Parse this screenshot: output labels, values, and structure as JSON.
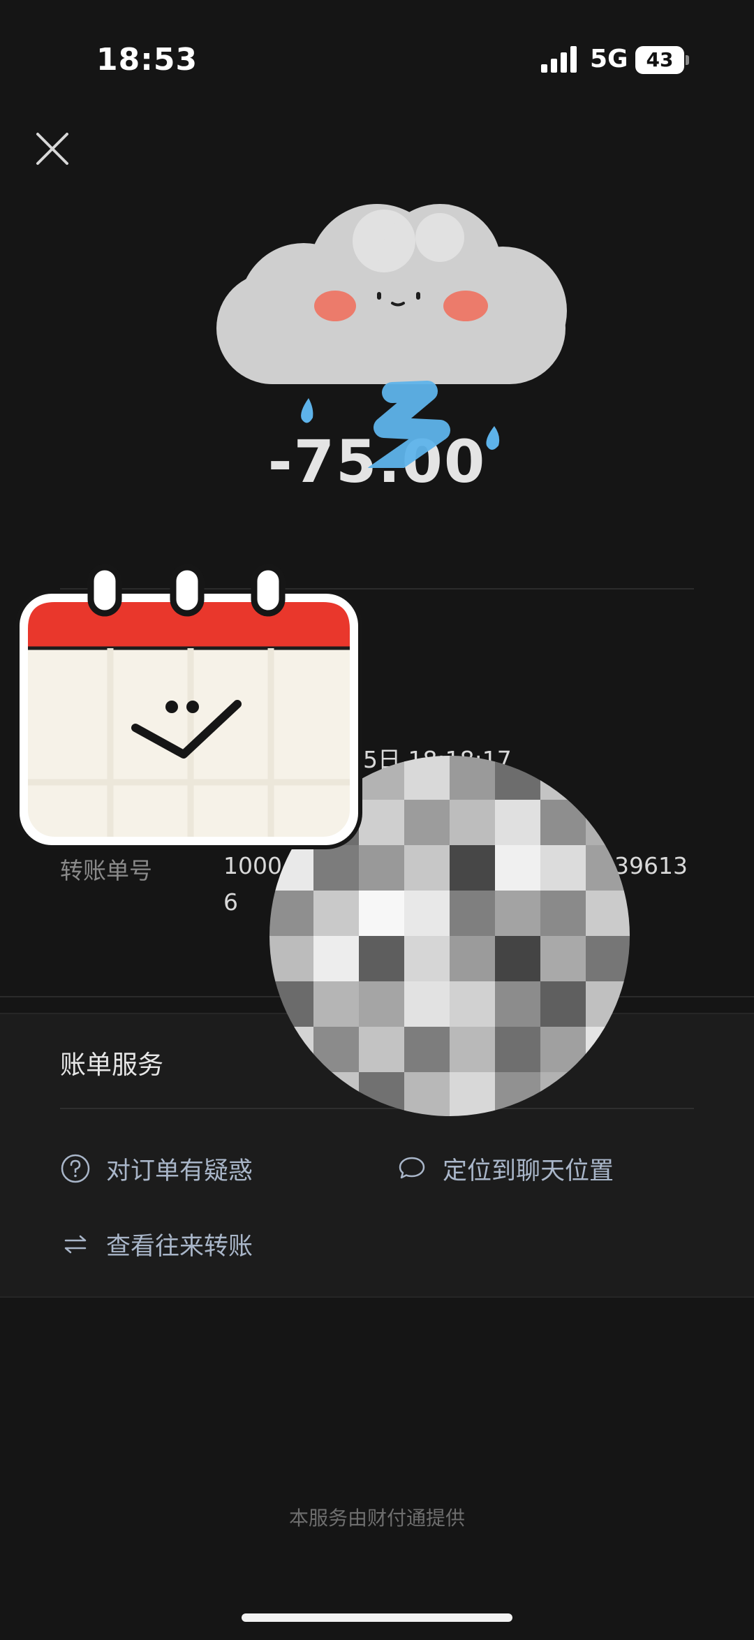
{
  "status_bar": {
    "time": "18:53",
    "network": "5G",
    "battery": "43"
  },
  "transaction": {
    "amount": "-75.00"
  },
  "details": {
    "time_value_fragment": "5日 18:18:17",
    "transfer_no_label": "转账单号",
    "transfer_no_value_start": "1000",
    "transfer_no_value_end": "39613",
    "transfer_no_value_line2": "6"
  },
  "service": {
    "title": "账单服务",
    "links": {
      "question_order": "对订单有疑惑",
      "locate_chat": "定位到聊天位置",
      "view_transfers": "查看往来转账"
    }
  },
  "footer": {
    "text": "本服务由财付通提供"
  },
  "colors": {
    "background": "#151515",
    "card": "#1c1c1c",
    "link": "#a9b6c9"
  },
  "icons": [
    "close-icon",
    "question-circle-icon",
    "chat-bubble-icon",
    "swap-arrows-icon",
    "signal-icon",
    "battery-icon"
  ]
}
